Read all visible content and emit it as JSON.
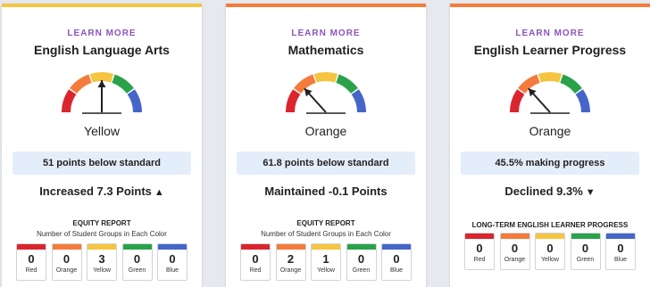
{
  "colors": {
    "red": "#d9262e",
    "orange": "#f47b3b",
    "yellow": "#f5c542",
    "green": "#2aa24a",
    "blue": "#4565c9",
    "link": "#8b56b8",
    "pill_bg": "#e4eefa"
  },
  "cards": [
    {
      "learn_more": "LEARN MORE",
      "title": "English Language Arts",
      "status": "Yellow",
      "level": "yellow",
      "summary": "51 points below standard",
      "change": "Increased 7.3 Points",
      "change_arrow": "▲",
      "report_title": "EQUITY REPORT",
      "report_subtitle": "Number of Student Groups in Each Color",
      "groups": [
        {
          "count": "0",
          "label": "Red"
        },
        {
          "count": "0",
          "label": "Orange"
        },
        {
          "count": "3",
          "label": "Yellow"
        },
        {
          "count": "0",
          "label": "Green"
        },
        {
          "count": "0",
          "label": "Blue"
        }
      ]
    },
    {
      "learn_more": "LEARN MORE",
      "title": "Mathematics",
      "status": "Orange",
      "level": "orange",
      "summary": "61.8 points below standard",
      "change": "Maintained -0.1 Points",
      "change_arrow": "",
      "report_title": "EQUITY REPORT",
      "report_subtitle": "Number of Student Groups in Each Color",
      "groups": [
        {
          "count": "0",
          "label": "Red"
        },
        {
          "count": "2",
          "label": "Orange"
        },
        {
          "count": "1",
          "label": "Yellow"
        },
        {
          "count": "0",
          "label": "Green"
        },
        {
          "count": "0",
          "label": "Blue"
        }
      ]
    },
    {
      "learn_more": "LEARN MORE",
      "title": "English Learner Progress",
      "status": "Orange",
      "level": "orange",
      "summary": "45.5% making progress",
      "change": "Declined 9.3%",
      "change_arrow": "▼",
      "report_title": "LONG-TERM ENGLISH LEARNER PROGRESS",
      "report_subtitle": "",
      "groups": [
        {
          "count": "0",
          "label": "Red"
        },
        {
          "count": "0",
          "label": "Orange"
        },
        {
          "count": "0",
          "label": "Yellow"
        },
        {
          "count": "0",
          "label": "Green"
        },
        {
          "count": "0",
          "label": "Blue"
        }
      ]
    }
  ]
}
